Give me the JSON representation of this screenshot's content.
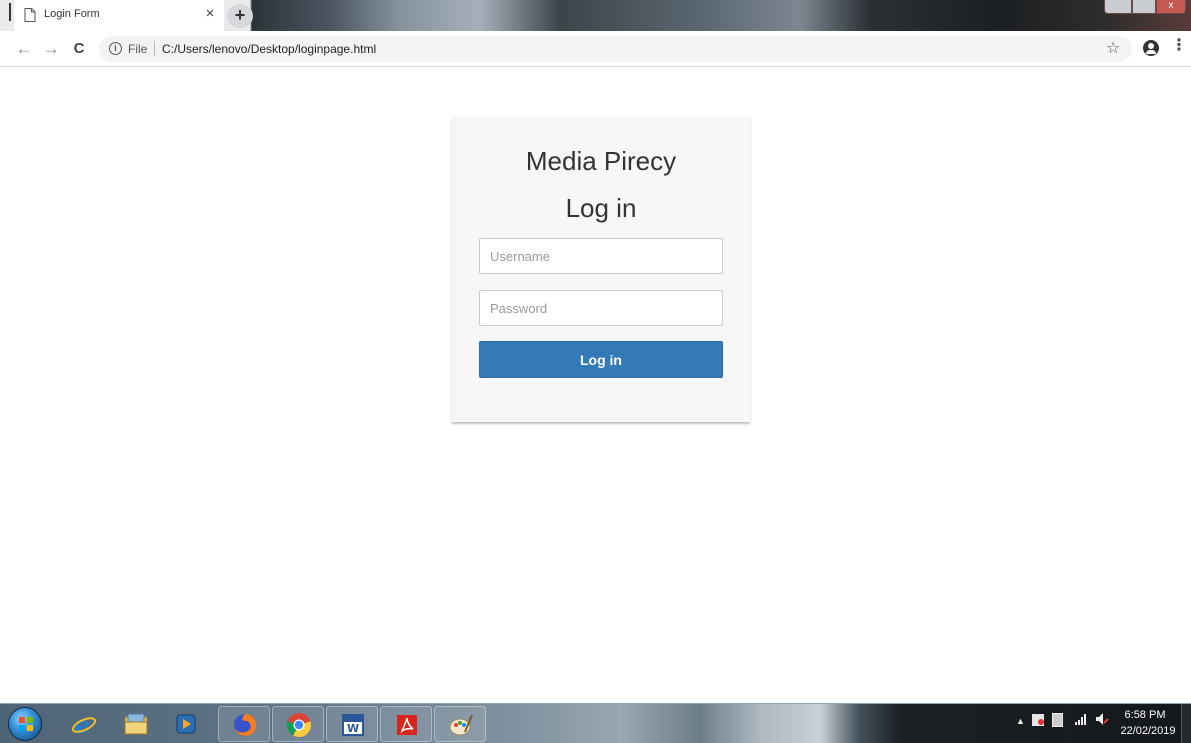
{
  "browser": {
    "tab_title": "Login Form",
    "tab_close_glyph": "×",
    "new_tab_glyph": "+",
    "window_close_glyph": "x",
    "back_glyph": "←",
    "forward_glyph": "→",
    "reload_glyph": "C",
    "info_glyph": "i",
    "url_scheme": "File",
    "url": "C:/Users/lenovo/Desktop/loginpage.html",
    "star_glyph": "☆",
    "menu_glyph": "⋮"
  },
  "page": {
    "site_title": "Media Pirecy",
    "form_title": "Log in",
    "username": {
      "value": "",
      "placeholder": "Username"
    },
    "password": {
      "value": "",
      "placeholder": "Password"
    },
    "submit_label": "Log in",
    "accent_color": "#337ab7",
    "card_background": "#f7f7f7"
  },
  "taskbar": {
    "apps": [
      "start-button",
      "internet-explorer",
      "file-explorer",
      "media-player",
      "firefox",
      "chrome",
      "word",
      "acrobat-reader",
      "paint"
    ],
    "tray_arrow_glyph": "▲",
    "clock_time": "6:58 PM",
    "clock_date": "22/02/2019"
  }
}
